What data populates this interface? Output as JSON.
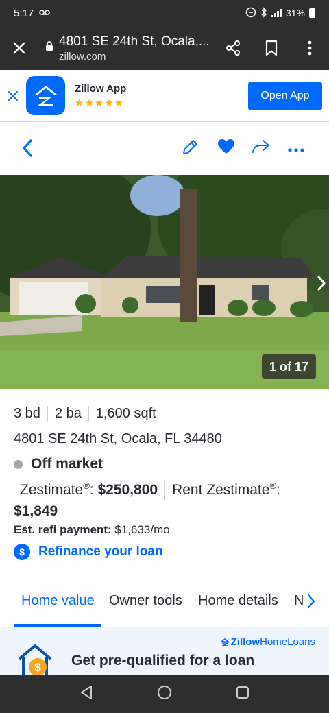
{
  "status_bar": {
    "time": "5:17",
    "battery": "31%"
  },
  "browser": {
    "title": "4801 SE 24th St, Ocala,...",
    "domain": "zillow.com"
  },
  "app_banner": {
    "name": "Zillow App",
    "stars": "★★★★★",
    "open_label": "Open App"
  },
  "photo": {
    "counter": "1 of 17"
  },
  "listing": {
    "beds": "3 bd",
    "baths": "2 ba",
    "sqft": "1,600 sqft",
    "address": "4801 SE 24th St, Ocala, FL 34480",
    "status": "Off market",
    "zestimate_label": "Zestimate",
    "zestimate_value": "$250,800",
    "rent_label": "Rent Zestimate",
    "rent_value": "$1,849",
    "registered_mark": "®",
    "refi_label": "Est. refi payment:",
    "refi_value": "$1,633/mo",
    "refi_link": "Refinance your loan",
    "dollar_symbol": "$"
  },
  "tabs": [
    "Home value",
    "Owner tools",
    "Home details",
    "Neighborhood"
  ],
  "loan_banner": {
    "brand_z": "Zillow",
    "brand_rest": "HomeLoans",
    "text": "Get pre-qualified for a loan",
    "coin_symbol": "$"
  },
  "colors": {
    "accent": "#006aff",
    "dark_bar": "#2e2e2e",
    "text": "#2a2a33",
    "star": "#ffb300"
  },
  "icons": [
    "close-icon",
    "lock-icon",
    "share-icon",
    "bookmark-icon",
    "more-vert-icon",
    "back-chevron-icon",
    "edit-pencil-icon",
    "heart-icon",
    "share-arrow-icon",
    "more-horiz-icon",
    "chevron-right-icon",
    "dollar-icon",
    "nav-back-icon",
    "nav-home-icon",
    "nav-recents-icon"
  ]
}
